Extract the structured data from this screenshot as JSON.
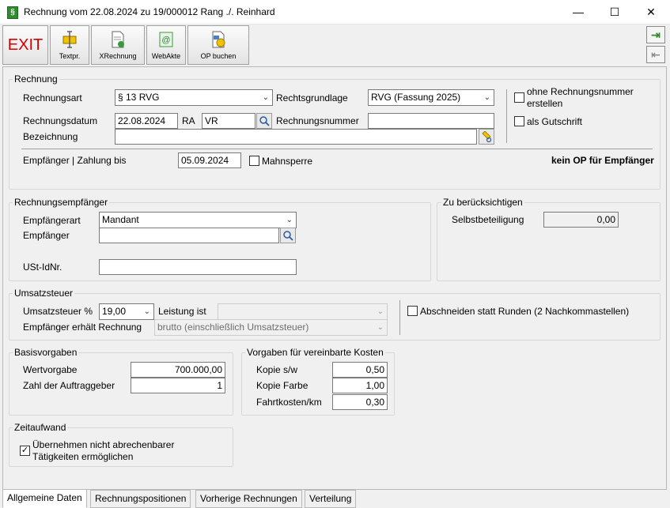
{
  "window": {
    "title": "Rechnung vom 22.08.2024 zu 19/000012 Rang ./. Reinhard",
    "app_icon_glyph": "§",
    "minimize_glyph": "—",
    "maximize_glyph": "☐",
    "close_glyph": "✕"
  },
  "toolbar": {
    "exit_label": "EXIT",
    "textpr_label": "Textpr.",
    "xrechnung_label": "XRechnung",
    "webakte_label": "WebAkte",
    "op_buchen_label": "OP buchen",
    "nav_forward_glyph": "⇥",
    "nav_back_glyph": "⇤"
  },
  "rechnung": {
    "group_title": "Rechnung",
    "rechnungsart_label": "Rechnungsart",
    "rechnungsart_value": "§ 13 RVG",
    "rechtsgrundlage_label": "Rechtsgrundlage",
    "rechtsgrundlage_value": "RVG (Fassung 2025)",
    "ohne_nummer_label_1": "ohne Rechnungsnummer",
    "ohne_nummer_label_2": "erstellen",
    "gutschrift_label": "als Gutschrift",
    "rechnungsdatum_label": "Rechnungsdatum",
    "rechnungsdatum_value": "22.08.2024",
    "ra_label": "RA",
    "ra_value": "VR",
    "rechnungsnummer_label": "Rechnungsnummer",
    "rechnungsnummer_value": "",
    "bezeichnung_label": "Bezeichnung",
    "bezeichnung_value": "",
    "empfaenger_zahlung_label": "Empfänger | Zahlung bis",
    "zahlung_bis_value": "05.09.2024",
    "mahnsperre_label": "Mahnsperre",
    "kein_op_text": "kein OP für Empfänger"
  },
  "rechnungsempfaenger": {
    "group_title": "Rechnungsempfänger",
    "empfaengerart_label": "Empfängerart",
    "empfaengerart_value": "Mandant",
    "empfaenger_label": "Empfänger",
    "empfaenger_value": "",
    "ustid_label": "USt-IdNr.",
    "ustid_value": ""
  },
  "zu_beruecksichtigen": {
    "group_title": "Zu berücksichtigen",
    "selbstbeteiligung_label": "Selbstbeteiligung",
    "selbstbeteiligung_value": "0,00"
  },
  "umsatzsteuer": {
    "group_title": "Umsatzsteuer",
    "ust_label": "Umsatzsteuer %",
    "ust_value": "19,00",
    "leistung_label": "Leistung ist",
    "leistung_value": "",
    "empfaenger_erhaelt_label": "Empfänger erhält Rechnung",
    "empfaenger_erhaelt_value": "brutto (einschließlich Umsatzsteuer)",
    "abschneiden_label": "Abschneiden statt Runden (2 Nachkommastellen)"
  },
  "basisvorgaben": {
    "group_title": "Basisvorgaben",
    "wertvorgabe_label": "Wertvorgabe",
    "wertvorgabe_value": "700.000,00",
    "auftraggeber_label": "Zahl der Auftraggeber",
    "auftraggeber_value": "1"
  },
  "kosten": {
    "group_title": "Vorgaben für vereinbarte Kosten",
    "kopie_sw_label": "Kopie s/w",
    "kopie_sw_value": "0,50",
    "kopie_farbe_label": "Kopie Farbe",
    "kopie_farbe_value": "1,00",
    "fahrtkosten_label": "Fahrtkosten/km",
    "fahrtkosten_value": "0,30"
  },
  "zeitaufwand": {
    "group_title": "Zeitaufwand",
    "uebernehmen_label_1": "Übernehmen nicht abrechenbarer",
    "uebernehmen_label_2": "Tätigkeiten ermöglichen",
    "checked_glyph": "✓"
  },
  "tabs": [
    {
      "label": "Allgemeine Daten"
    },
    {
      "label": "Rechnungspositionen"
    },
    {
      "label": "Vorherige Rechnungen"
    },
    {
      "label": "Verteilung"
    }
  ],
  "icons": {
    "chevron": "⌄",
    "search": "🔍",
    "browse": "…"
  },
  "colors": {
    "exit_red": "#d40000",
    "nav_green": "#2e8b2e"
  }
}
